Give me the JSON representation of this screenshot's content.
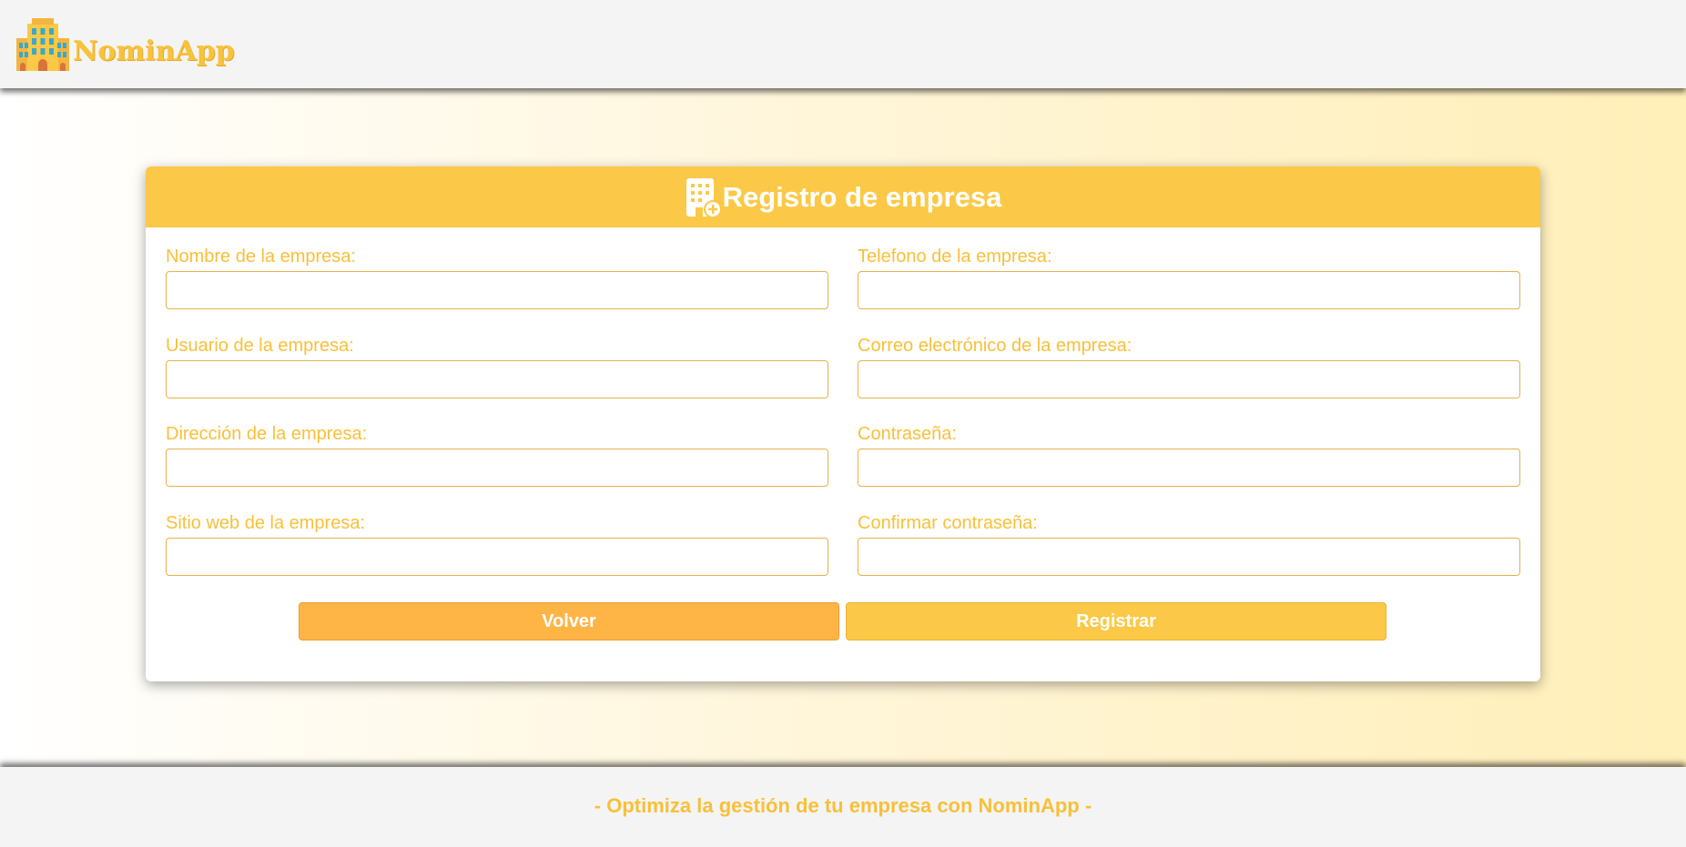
{
  "app": {
    "name": "NominApp",
    "colors": {
      "primary": "#fbc947",
      "accent": "#ffb446",
      "label": "#f8c03a",
      "header_bg": "#f4f4f4"
    }
  },
  "card": {
    "icon": "building-plus-icon",
    "title": "Registro de empresa"
  },
  "form": {
    "fields_left": [
      {
        "label": "Nombre de la empresa:",
        "value": ""
      },
      {
        "label": "Usuario de la empresa:",
        "value": ""
      },
      {
        "label": "Dirección de la empresa:",
        "value": ""
      },
      {
        "label": "Sitio web de la empresa:",
        "value": ""
      }
    ],
    "fields_right": [
      {
        "label": "Telefono de la empresa:",
        "value": ""
      },
      {
        "label": "Correo electrónico de la empresa:",
        "value": ""
      },
      {
        "label": "Contraseña:",
        "value": ""
      },
      {
        "label": "Confirmar contraseña:",
        "value": ""
      }
    ]
  },
  "buttons": {
    "back_label": "Volver",
    "register_label": "Registrar"
  },
  "footer": {
    "tagline": "- Optimiza la gestión de tu empresa con NominApp -"
  }
}
